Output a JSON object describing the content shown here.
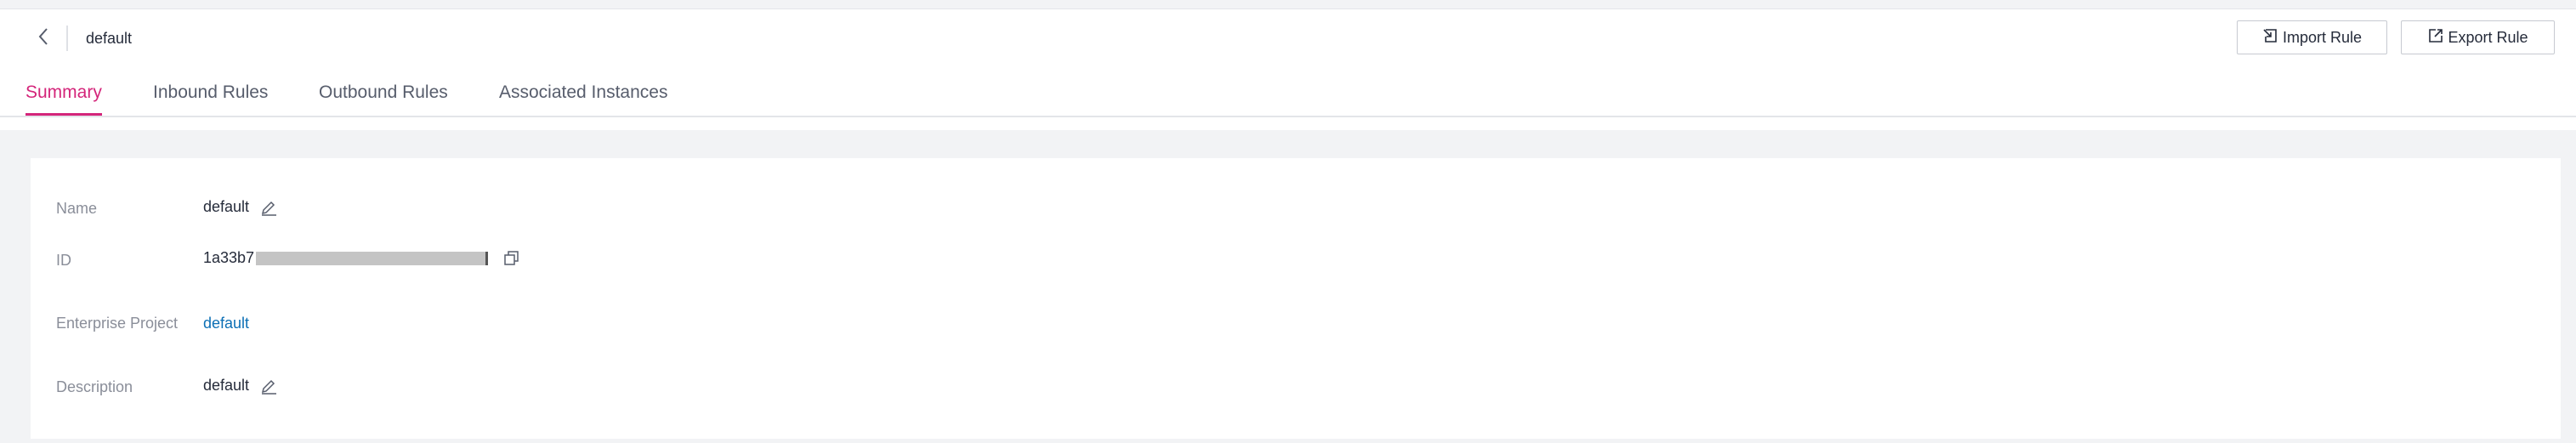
{
  "header": {
    "title": "default",
    "back_icon": "chevron-left-icon",
    "buttons": {
      "import_label": "Import Rule",
      "import_icon": "import-icon",
      "export_label": "Export Rule",
      "export_icon": "export-icon"
    }
  },
  "tabs": [
    {
      "label": "Summary",
      "active": true
    },
    {
      "label": "Inbound Rules",
      "active": false
    },
    {
      "label": "Outbound Rules",
      "active": false
    },
    {
      "label": "Associated Instances",
      "active": false
    }
  ],
  "summary": {
    "name": {
      "label": "Name",
      "value": "default",
      "icon": "edit-icon"
    },
    "id": {
      "label": "ID",
      "value": "1a33b7",
      "icon": "copy-icon"
    },
    "enterprise_project": {
      "label": "Enterprise Project",
      "value": "default"
    },
    "description": {
      "label": "Description",
      "value": "default",
      "icon": "edit-icon"
    }
  },
  "colors": {
    "accent": "#d4257a",
    "link": "#0c6fb5",
    "label": "#8a8e99",
    "text": "#252b3a",
    "page_bg": "#f2f3f5"
  }
}
